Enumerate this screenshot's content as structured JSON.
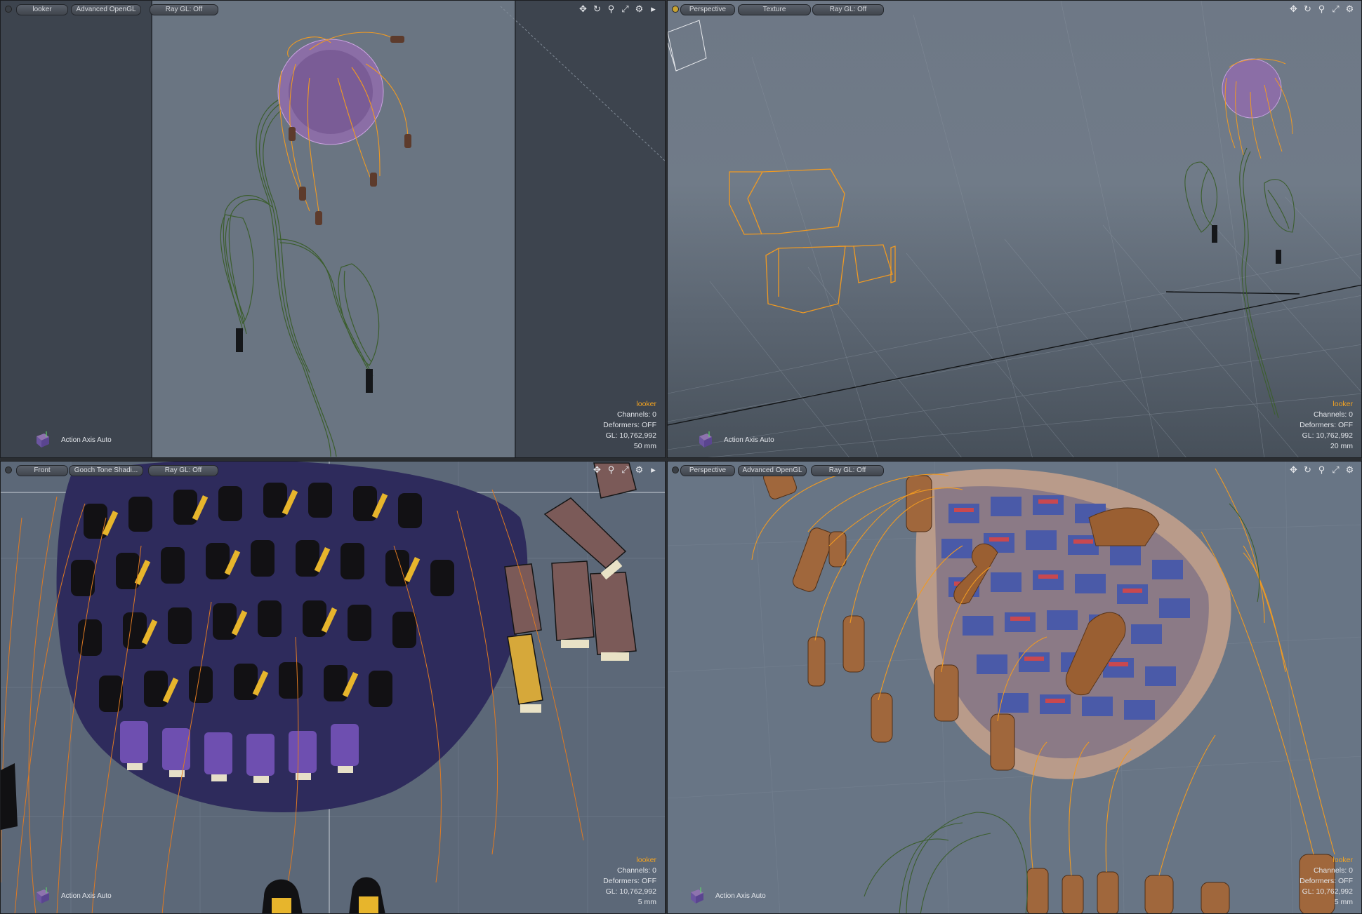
{
  "viewports": [
    {
      "tabs": [
        "looker",
        "Advanced OpenGL",
        "Ray GL: Off"
      ],
      "info": {
        "name": "looker",
        "channels": "Channels: 0",
        "deformers": "Deformers: OFF",
        "gl": "GL: 10,762,992",
        "scale": "50 mm"
      },
      "action_axis": "Action Axis Auto"
    },
    {
      "tabs": [
        "Perspective",
        "Texture",
        "Ray GL: Off"
      ],
      "info": {
        "name": "looker",
        "channels": "Channels: 0",
        "deformers": "Deformers: OFF",
        "gl": "GL: 10,762,992",
        "scale": "20 mm"
      },
      "action_axis": "Action Axis Auto"
    },
    {
      "tabs": [
        "Front",
        "Gooch Tone Shadi...",
        "Ray GL: Off"
      ],
      "info": {
        "name": "looker",
        "channels": "Channels: 0",
        "deformers": "Deformers: OFF",
        "gl": "GL: 10,762,992",
        "scale": "5 mm"
      },
      "action_axis": "Action Axis Auto"
    },
    {
      "tabs": [
        "Perspective",
        "Advanced OpenGL",
        "Ray GL: Off"
      ],
      "info": {
        "name": "looker",
        "channels": "Channels: 0",
        "deformers": "Deformers: OFF",
        "gl": "GL: 10,762,992",
        "scale": "5 mm"
      },
      "action_axis": "Action Axis Auto"
    }
  ],
  "toolbar_icons": [
    "move-icon",
    "rotate-icon",
    "zoom-icon",
    "maximize-icon",
    "gear-icon",
    "menu-arrow-icon"
  ],
  "colors": {
    "accent": "#f3a320",
    "wire_orange": "#f09a22",
    "stem_green": "#3c5e2e",
    "head_purple": "#8d6fa8"
  }
}
